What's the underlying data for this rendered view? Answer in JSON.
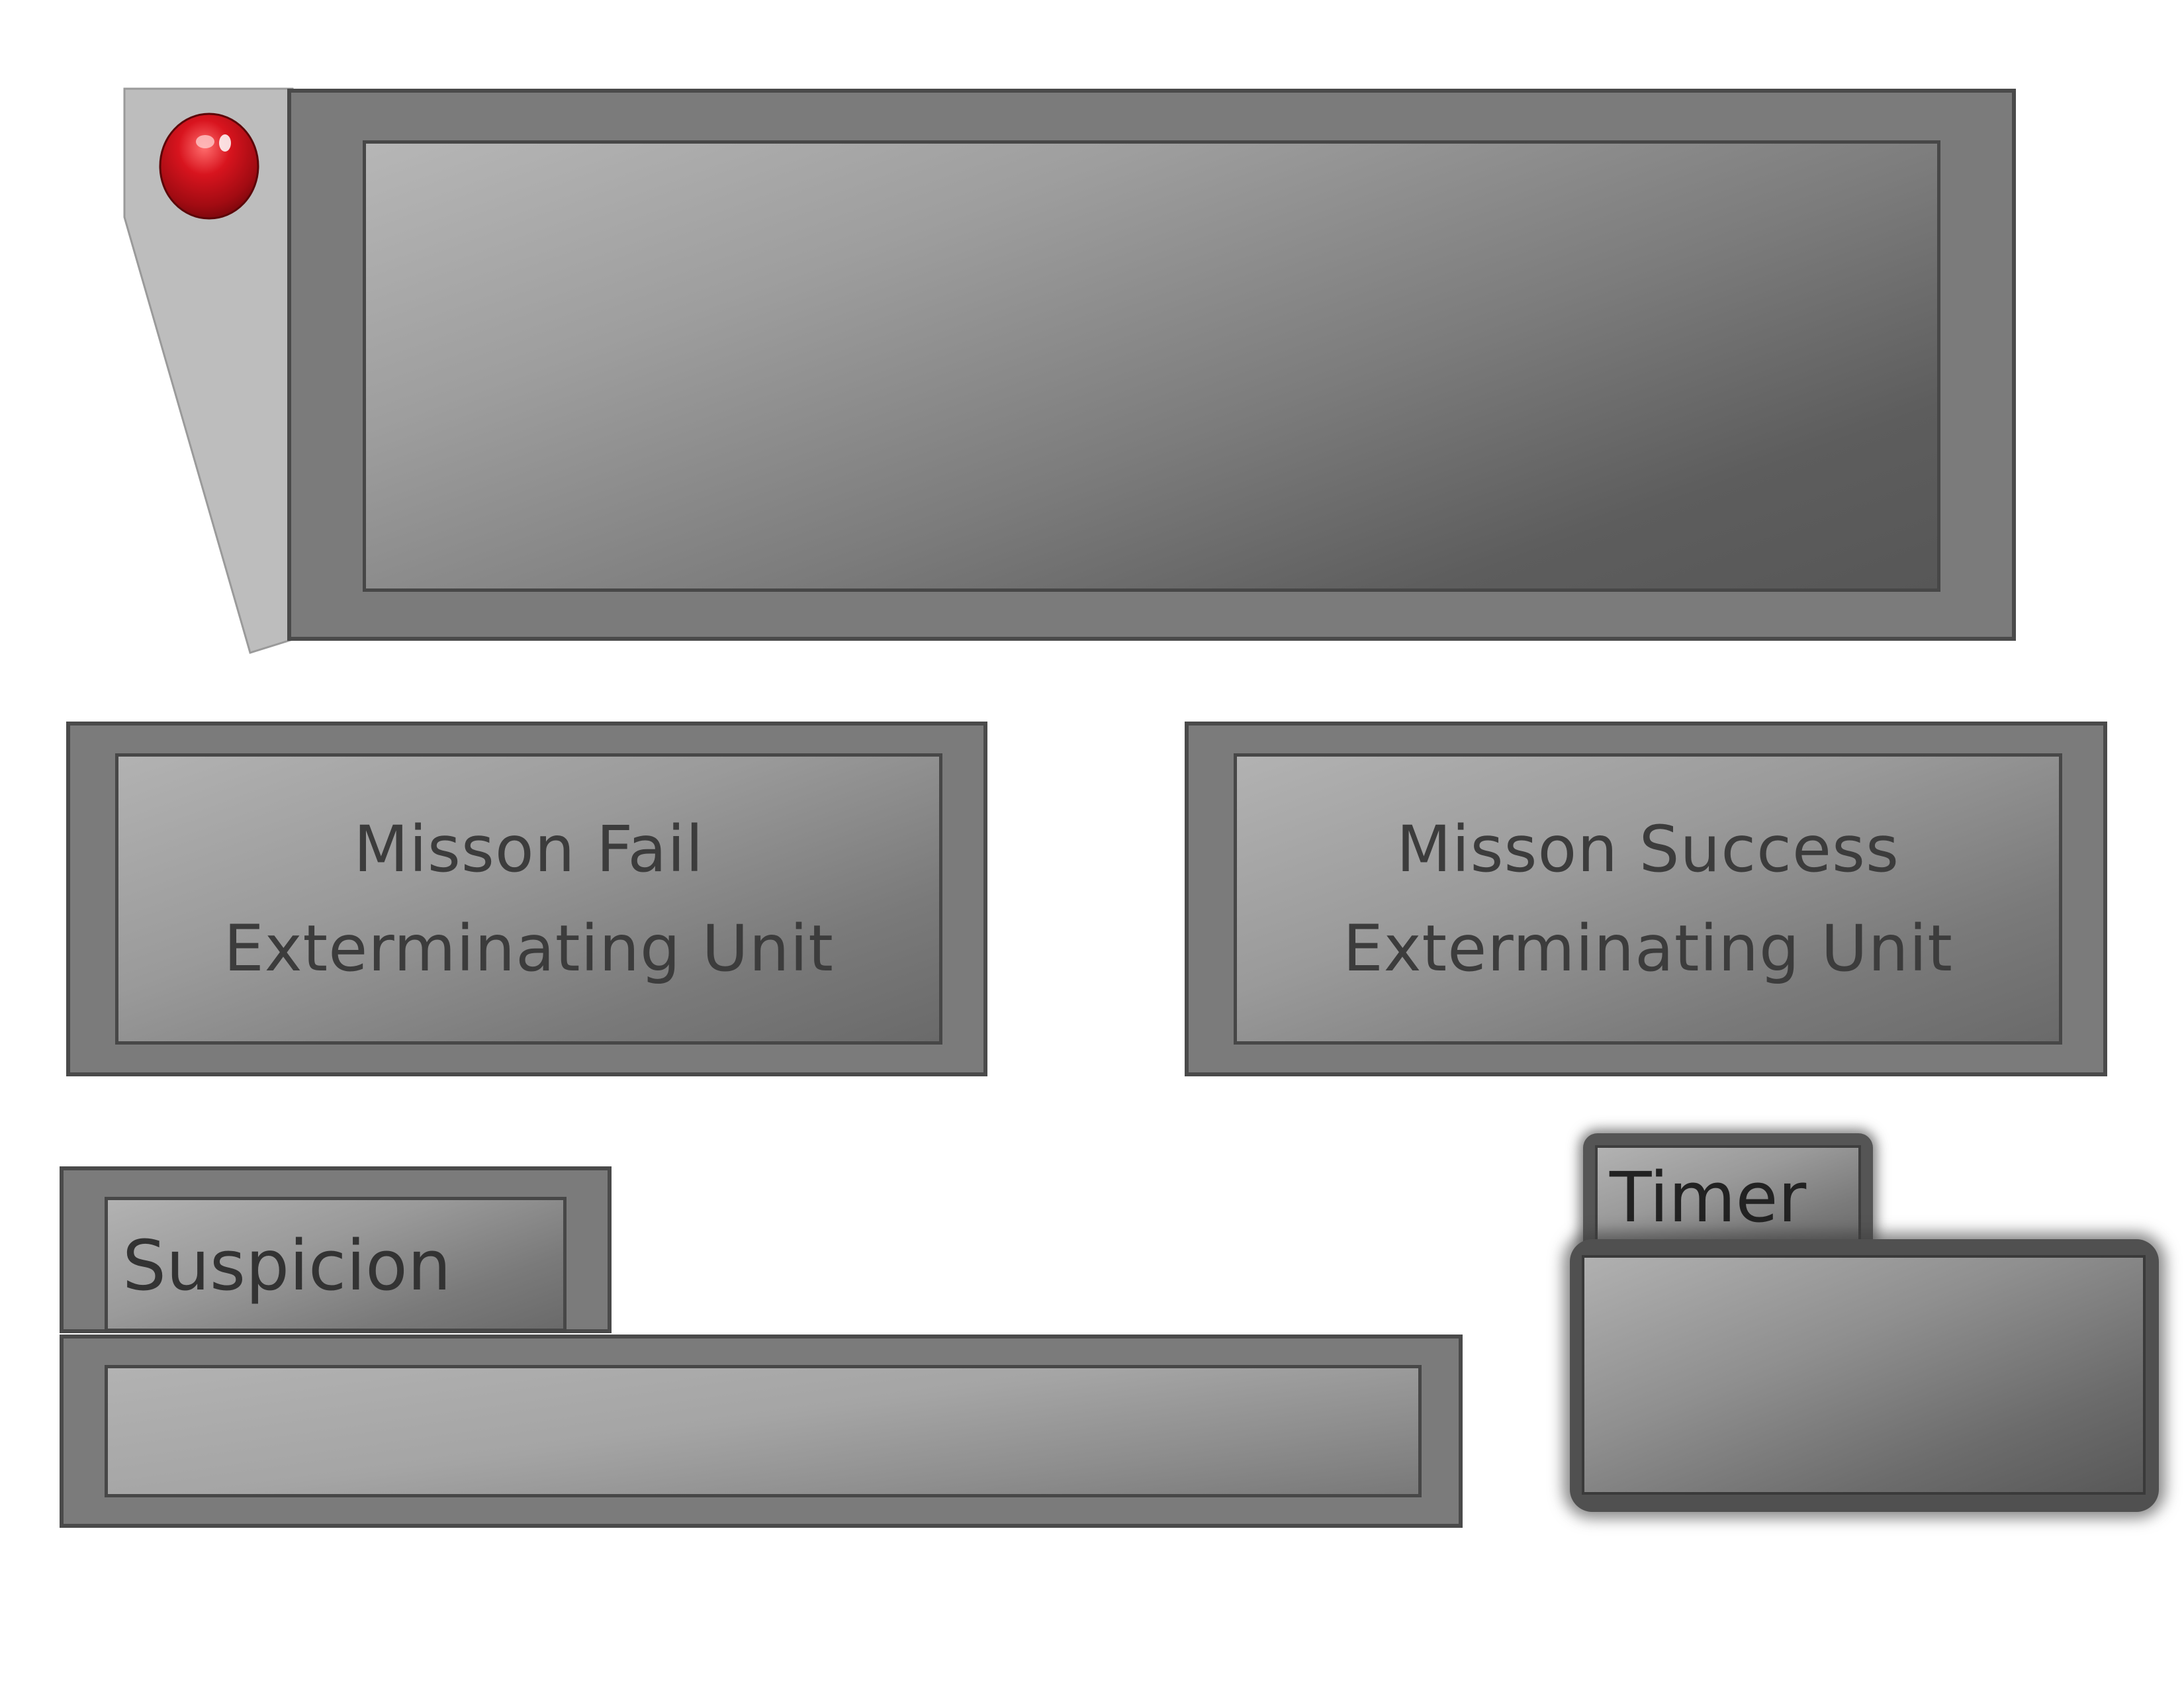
{
  "colors": {
    "frame": "#7b7b7b",
    "frame_border": "#4a4a4a",
    "bracket": "#bdbdbd",
    "alarm_light": "#c40d16",
    "text": "#3c3c3c"
  },
  "icons": {
    "alarm_light": "red-alarm-light-icon"
  },
  "panels": {
    "mission_fail": {
      "line1": "Misson Fail",
      "line2": "Exterminating Unit"
    },
    "mission_success": {
      "line1": "Misson Success",
      "line2": "Exterminating Unit"
    }
  },
  "suspicion": {
    "label": "Suspicion"
  },
  "timer": {
    "label": "Timer"
  }
}
